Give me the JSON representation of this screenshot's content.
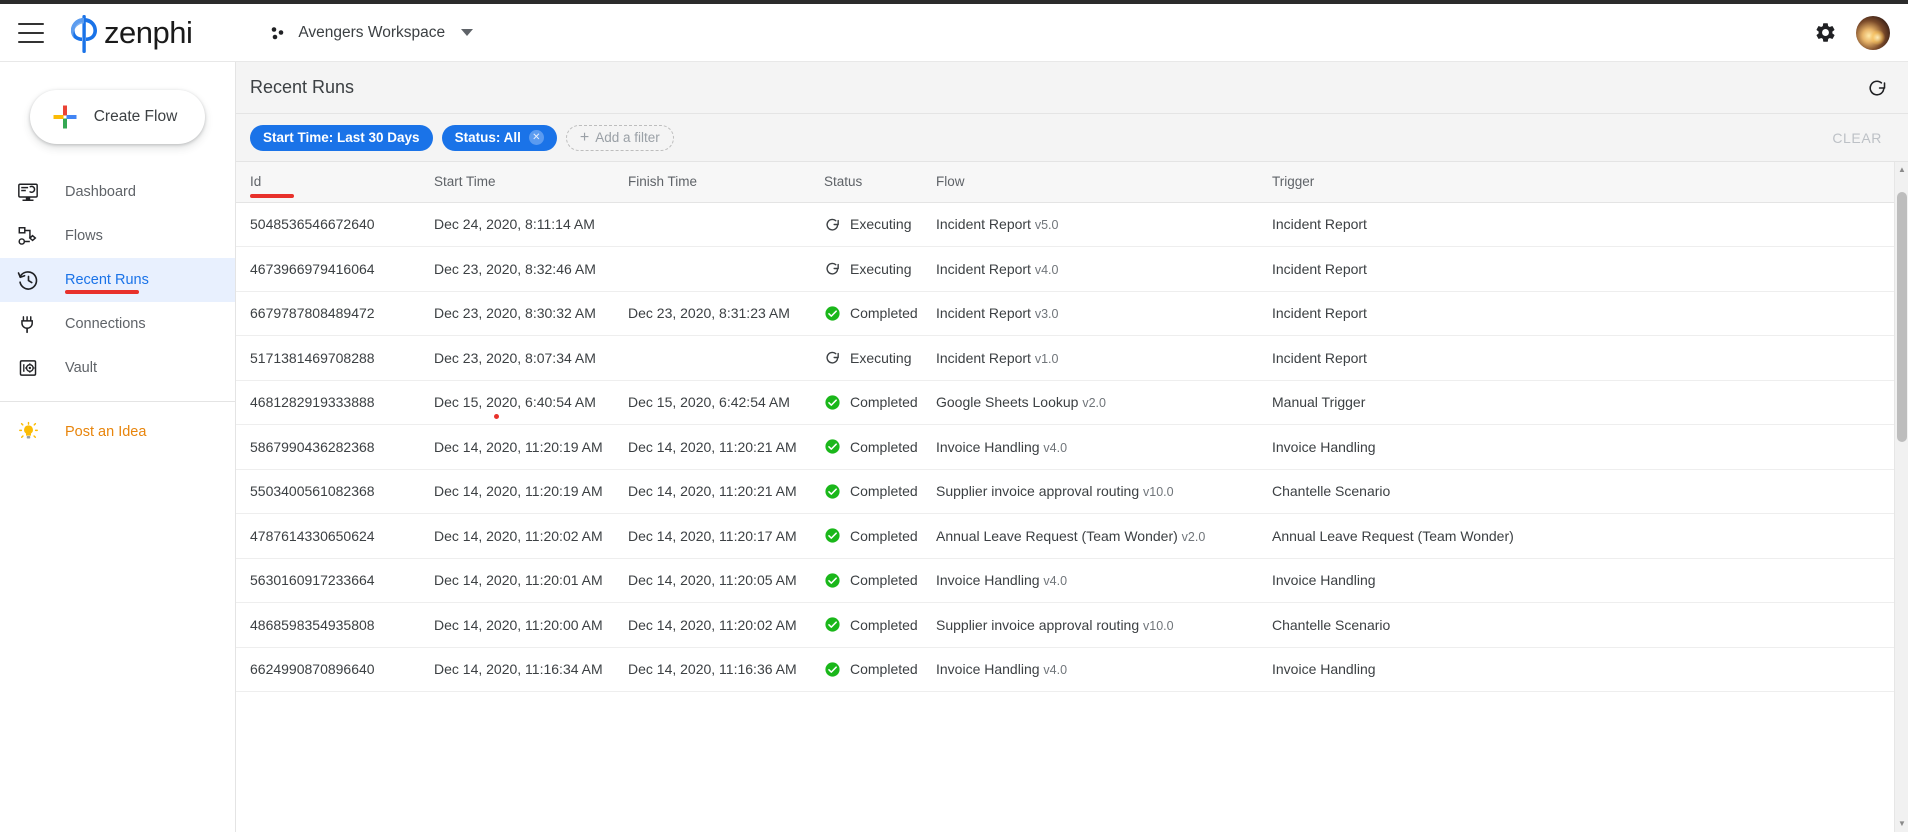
{
  "app": {
    "brand_name": "zenphi",
    "menu_icon": "hamburger-icon",
    "workspace": "Avengers Workspace",
    "gear_icon": "gear-icon",
    "avatar_icon": "user-avatar"
  },
  "sidebar": {
    "create_flow_label": "Create Flow",
    "items": [
      {
        "label": "Dashboard",
        "icon": "dashboard-monitor-icon",
        "active": false
      },
      {
        "label": "Flows",
        "icon": "flows-nodes-icon",
        "active": false
      },
      {
        "label": "Recent Runs",
        "icon": "history-clock-icon",
        "active": true
      },
      {
        "label": "Connections",
        "icon": "plug-icon",
        "active": false
      },
      {
        "label": "Vault",
        "icon": "vault-safe-icon",
        "active": false
      }
    ],
    "footer_item": {
      "label": "Post an Idea",
      "icon": "lightbulb-icon"
    }
  },
  "panel": {
    "title": "Recent Runs",
    "refresh_icon": "refresh-icon"
  },
  "filters": {
    "chips": [
      {
        "label": "Start Time: Last 30 Days",
        "removable": false
      },
      {
        "label": "Status: All",
        "removable": true
      }
    ],
    "add_filter_label": "Add a filter",
    "clear_label": "CLEAR"
  },
  "table": {
    "columns": [
      "Id",
      "Start Time",
      "Finish Time",
      "Status",
      "Flow",
      "Trigger"
    ],
    "rows": [
      {
        "id": "5048536546672640",
        "start": "Dec 24, 2020, 8:11:14 AM",
        "finish": "",
        "status": "Executing",
        "status_icon": "executing-spinner-icon",
        "flow": "Incident Report",
        "version": "v5.0",
        "trigger": "Incident Report"
      },
      {
        "id": "4673966979416064",
        "start": "Dec 23, 2020, 8:32:46 AM",
        "finish": "",
        "status": "Executing",
        "status_icon": "executing-spinner-icon",
        "flow": "Incident Report",
        "version": "v4.0",
        "trigger": "Incident Report"
      },
      {
        "id": "6679787808489472",
        "start": "Dec 23, 2020, 8:30:32 AM",
        "finish": "Dec 23, 2020, 8:31:23 AM",
        "status": "Completed",
        "status_icon": "completed-check-icon",
        "flow": "Incident Report",
        "version": "v3.0",
        "trigger": "Incident Report"
      },
      {
        "id": "5171381469708288",
        "start": "Dec 23, 2020, 8:07:34 AM",
        "finish": "",
        "status": "Executing",
        "status_icon": "executing-spinner-icon",
        "flow": "Incident Report",
        "version": "v1.0",
        "trigger": "Incident Report"
      },
      {
        "id": "4681282919333888",
        "start": "Dec 15, 2020, 6:40:54 AM",
        "finish": "Dec 15, 2020, 6:42:54 AM",
        "status": "Completed",
        "status_icon": "completed-check-icon",
        "flow": "Google Sheets Lookup",
        "version": "v2.0",
        "trigger": "Manual Trigger"
      },
      {
        "id": "5867990436282368",
        "start": "Dec 14, 2020, 11:20:19 AM",
        "finish": "Dec 14, 2020, 11:20:21 AM",
        "status": "Completed",
        "status_icon": "completed-check-icon",
        "flow": "Invoice Handling",
        "version": "v4.0",
        "trigger": "Invoice Handling"
      },
      {
        "id": "5503400561082368",
        "start": "Dec 14, 2020, 11:20:19 AM",
        "finish": "Dec 14, 2020, 11:20:21 AM",
        "status": "Completed",
        "status_icon": "completed-check-icon",
        "flow": "Supplier invoice approval routing",
        "version": "v10.0",
        "trigger": "Chantelle Scenario"
      },
      {
        "id": "4787614330650624",
        "start": "Dec 14, 2020, 11:20:02 AM",
        "finish": "Dec 14, 2020, 11:20:17 AM",
        "status": "Completed",
        "status_icon": "completed-check-icon",
        "flow": "Annual Leave Request (Team Wonder)",
        "version": "v2.0",
        "trigger": "Annual Leave Request (Team Wonder)"
      },
      {
        "id": "5630160917233664",
        "start": "Dec 14, 2020, 11:20:01 AM",
        "finish": "Dec 14, 2020, 11:20:05 AM",
        "status": "Completed",
        "status_icon": "completed-check-icon",
        "flow": "Invoice Handling",
        "version": "v4.0",
        "trigger": "Invoice Handling"
      },
      {
        "id": "4868598354935808",
        "start": "Dec 14, 2020, 11:20:00 AM",
        "finish": "Dec 14, 2020, 11:20:02 AM",
        "status": "Completed",
        "status_icon": "completed-check-icon",
        "flow": "Supplier invoice approval routing",
        "version": "v10.0",
        "trigger": "Chantelle Scenario"
      },
      {
        "id": "6624990870896640",
        "start": "Dec 14, 2020, 11:16:34 AM",
        "finish": "Dec 14, 2020, 11:16:36 AM",
        "status": "Completed",
        "status_icon": "completed-check-icon",
        "flow": "Invoice Handling",
        "version": "v4.0",
        "trigger": "Invoice Handling"
      }
    ]
  },
  "annotations": {
    "underline_nav": "red-underline-recent-runs",
    "underline_col": "red-underline-id-column",
    "dot_row": "red-dot-row-5"
  },
  "colors": {
    "accent_blue": "#1a73e8",
    "active_bg": "#e8f0fe",
    "completed_green": "#1ab71a",
    "annotation_red": "#e8312b",
    "idea_orange": "#e8850c",
    "text_primary": "#3c4043",
    "text_secondary": "#5f6368"
  }
}
